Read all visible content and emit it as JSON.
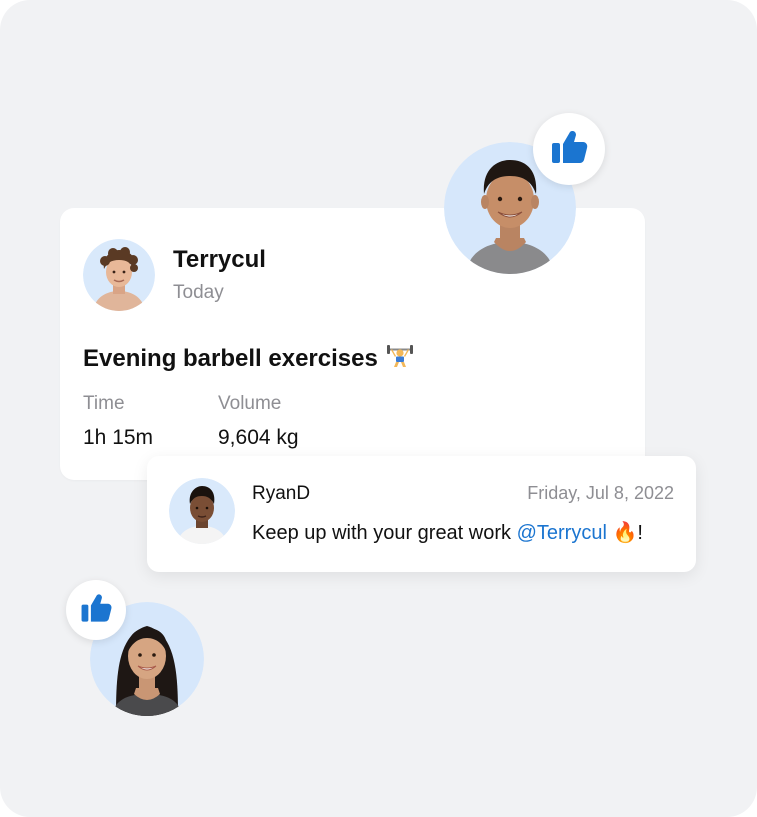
{
  "post": {
    "author_name": "Terrycul",
    "date": "Today",
    "title": "Evening barbell exercises",
    "title_emoji": "weightlifter-emoji",
    "stats": [
      {
        "label": "Time",
        "value": "1h 15m"
      },
      {
        "label": "Volume",
        "value": "9,604 kg"
      }
    ]
  },
  "comment": {
    "author_name": "RyanD",
    "date": "Friday, Jul 8, 2022",
    "text_prefix": "Keep up with your great work ",
    "mention": "@Terrycul",
    "emoji": "🔥",
    "text_suffix": "!"
  },
  "likes": [
    {
      "icon": "thumbs-up-icon"
    },
    {
      "icon": "thumbs-up-icon"
    }
  ],
  "colors": {
    "background": "#f1f2f4",
    "accent_blue": "#1b75d0",
    "muted_text": "#8e8e93",
    "avatar_bg": "#d6e7fb"
  }
}
